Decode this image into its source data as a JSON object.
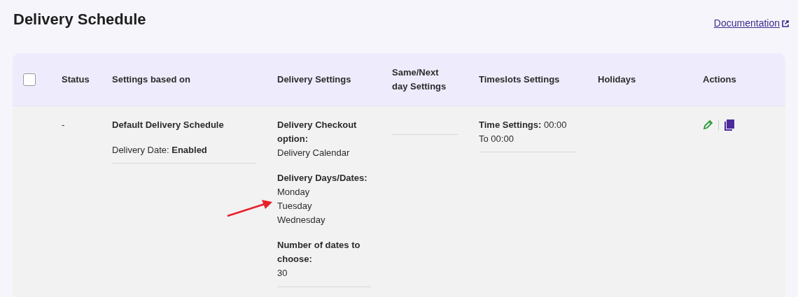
{
  "page": {
    "title": "Delivery Schedule",
    "documentation_link": "Documentation"
  },
  "table": {
    "select_all": {
      "checked": false
    },
    "columns": [
      "Status",
      "Settings based on",
      "Delivery Settings",
      "Same/Next day Settings",
      "Timeslots Settings",
      "Holidays",
      "Actions"
    ],
    "rows": [
      {
        "status": "-",
        "settings_based_on": {
          "title": "Default Delivery Schedule",
          "detail": "Delivery Date: **Enabled**"
        },
        "delivery_settings": [
          {
            "label": "Delivery Checkout option:",
            "values": [
              "Delivery Calendar"
            ]
          },
          {
            "label": "Delivery Days/Dates:",
            "values": [
              "Monday",
              "Tuesday",
              "Wednesday"
            ]
          },
          {
            "label": "Number of dates to choose:",
            "values": [
              "30"
            ]
          }
        ],
        "timeslots_settings": "**Time Settings:** 00:00 To 00:00"
      }
    ]
  }
}
